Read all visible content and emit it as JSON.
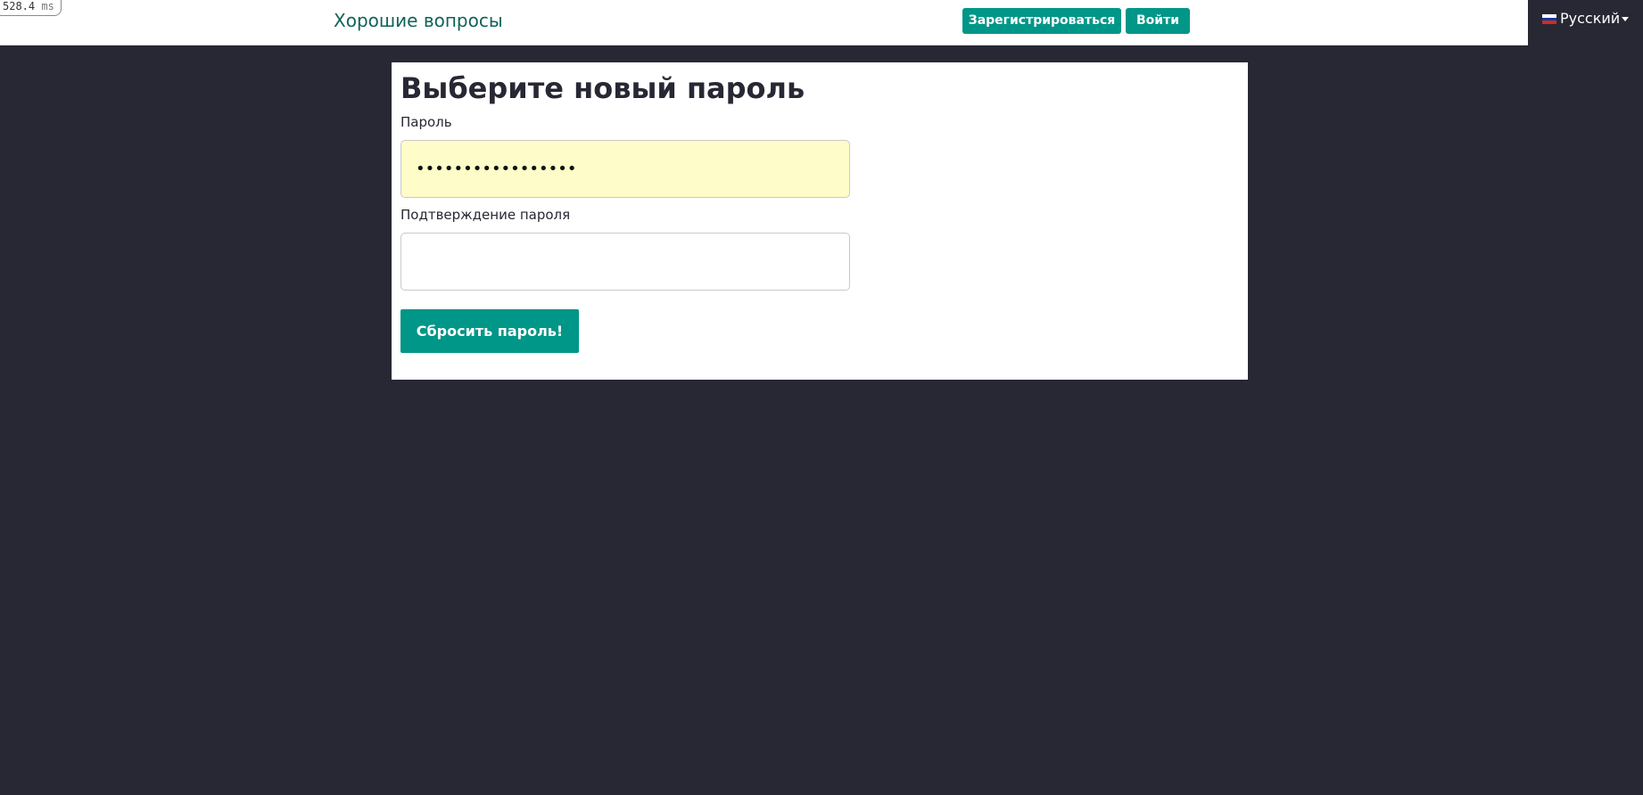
{
  "debug": {
    "timing_value": "528.4",
    "timing_unit": "ms"
  },
  "header": {
    "brand": "Хорошие вопросы",
    "register_label": "Зарегистрироваться",
    "login_label": "Войти",
    "language": {
      "label": "Русский",
      "flag_icon": "russia-flag-icon",
      "flag_colors": [
        "#ffffff",
        "#0039a6",
        "#d52b1e"
      ]
    }
  },
  "form": {
    "title": "Выберите новый пароль",
    "password_label": "Пароль",
    "password_value": "•••••••••••••••••",
    "confirm_label": "Подтверждение пароля",
    "confirm_value": "",
    "submit_label": "Сбросить пароль!"
  },
  "colors": {
    "accent": "#009688",
    "brand_text": "#0f6357",
    "page_background": "#272833",
    "autofill_background": "#fefcc8"
  }
}
